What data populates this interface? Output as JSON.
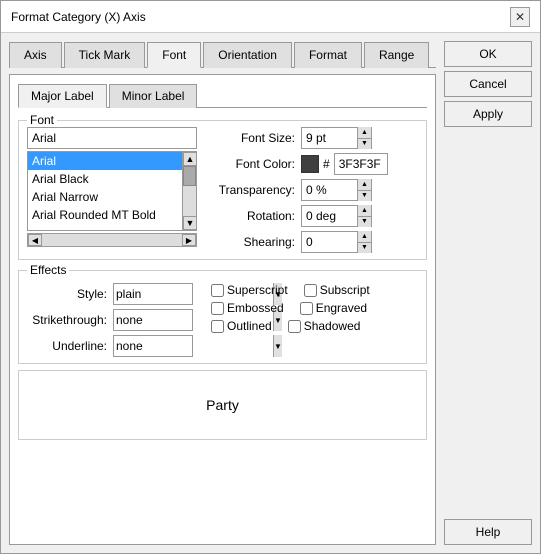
{
  "dialog": {
    "title": "Format Category (X) Axis",
    "close_label": "✕"
  },
  "tabs": {
    "items": [
      {
        "label": "Axis",
        "active": false
      },
      {
        "label": "Tick Mark",
        "active": false
      },
      {
        "label": "Font",
        "active": true
      },
      {
        "label": "Orientation",
        "active": false
      },
      {
        "label": "Format",
        "active": false
      },
      {
        "label": "Range",
        "active": false
      }
    ]
  },
  "inner_tabs": {
    "items": [
      {
        "label": "Major Label",
        "active": true
      },
      {
        "label": "Minor Label",
        "active": false
      }
    ]
  },
  "font_section": {
    "label": "Font",
    "input_value": "Arial",
    "list_items": [
      {
        "label": "Arial",
        "selected": true
      },
      {
        "label": "Arial Black",
        "selected": false
      },
      {
        "label": "Arial Narrow",
        "selected": false
      },
      {
        "label": "Arial Rounded MT Bold",
        "selected": false
      }
    ]
  },
  "font_props": {
    "size_label": "Font Size:",
    "size_value": "9 pt",
    "color_label": "Font Color:",
    "color_hex": "3F3F3F",
    "color_swatch": "#3F3F3F",
    "transparency_label": "Transparency:",
    "transparency_value": "0 %",
    "rotation_label": "Rotation:",
    "rotation_value": "0 deg",
    "shearing_label": "Shearing:",
    "shearing_value": "0"
  },
  "effects": {
    "title": "Effects",
    "style_label": "Style:",
    "style_value": "plain",
    "strikethrough_label": "Strikethrough:",
    "strikethrough_value": "none",
    "underline_label": "Underline:",
    "underline_value": "none",
    "checkboxes": [
      {
        "label": "Superscript",
        "checked": false
      },
      {
        "label": "Subscript",
        "checked": false
      },
      {
        "label": "Embossed",
        "checked": false
      },
      {
        "label": "Engraved",
        "checked": false
      },
      {
        "label": "Outlined",
        "checked": false
      },
      {
        "label": "Shadowed",
        "checked": false
      }
    ]
  },
  "preview": {
    "text": "Party"
  },
  "buttons": {
    "ok": "OK",
    "cancel": "Cancel",
    "apply": "Apply",
    "help": "Help"
  }
}
